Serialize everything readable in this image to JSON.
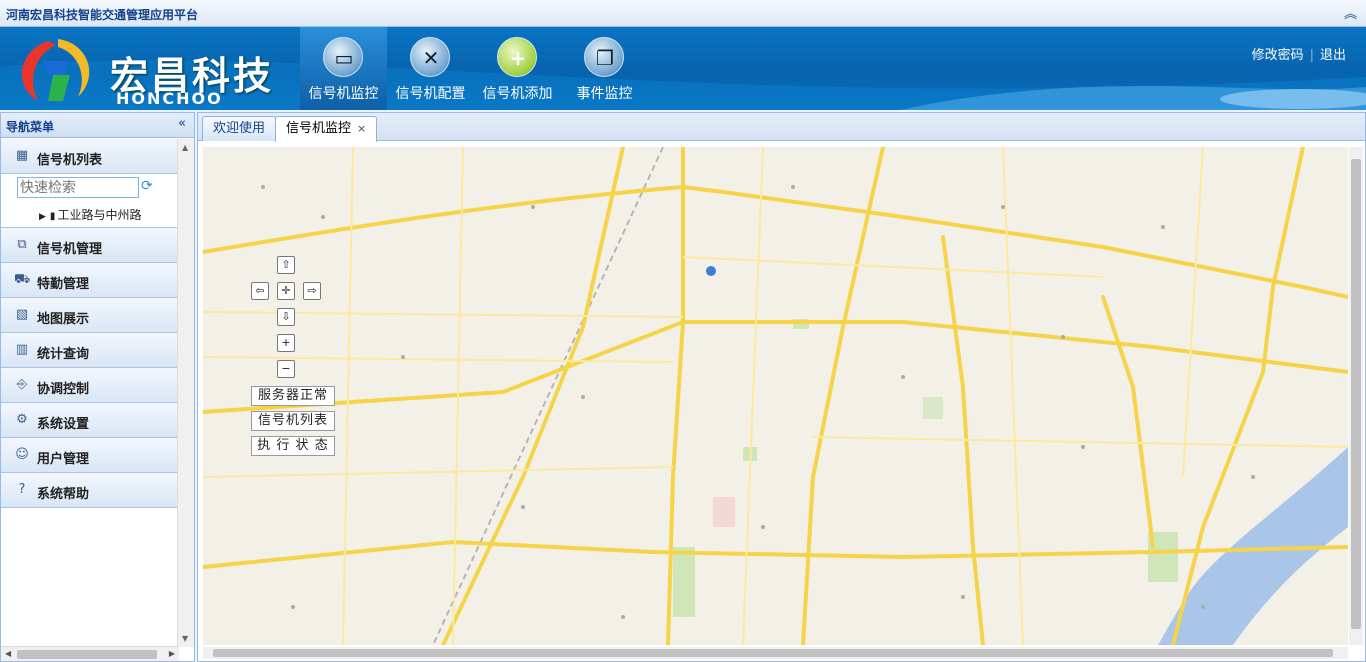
{
  "app": {
    "title": "河南宏昌科技智能交通管理应用平台"
  },
  "header": {
    "brand": "宏昌科技",
    "brand_en": "HONCHOO",
    "nav": [
      {
        "label": "信号机监控",
        "icon": "monitor-icon"
      },
      {
        "label": "信号机配置",
        "icon": "tools-icon"
      },
      {
        "label": "信号机添加",
        "icon": "add-icon"
      },
      {
        "label": "事件监控",
        "icon": "windows-icon"
      }
    ],
    "links": {
      "change_password": "修改密码",
      "logout": "退出"
    }
  },
  "sidebar": {
    "title": "导航菜单",
    "search_placeholder": "快速检索",
    "tree_item": "工业路与中州路",
    "items": [
      {
        "label": "信号机列表",
        "icon": "calendar-icon"
      },
      {
        "label": "信号机管理",
        "icon": "signal-manage-icon"
      },
      {
        "label": "特勤管理",
        "icon": "car-icon"
      },
      {
        "label": "地图展示",
        "icon": "map-icon"
      },
      {
        "label": "统计查询",
        "icon": "bar-chart-icon"
      },
      {
        "label": "协调控制",
        "icon": "coordination-icon"
      },
      {
        "label": "系统设置",
        "icon": "gear-icon"
      },
      {
        "label": "用户管理",
        "icon": "user-icon"
      },
      {
        "label": "系统帮助",
        "icon": "help-icon"
      }
    ]
  },
  "tabs": [
    {
      "label": "欢迎使用"
    },
    {
      "label": "信号机监控",
      "close": "×"
    }
  ],
  "map": {
    "controls": {
      "up": "⇧",
      "left": "⇦",
      "center": "✛",
      "right": "⇨",
      "down": "⇩",
      "zoom_in": "+",
      "zoom_out": "−"
    },
    "buttons": {
      "server_status": "服务器正常",
      "signal_list": "信号机列表",
      "exec_status": "执 行 状 态"
    }
  },
  "colors": {
    "header_blue": "#0763ad",
    "panel_border": "#99bbe8",
    "road_yellow": "#f5d44a"
  }
}
